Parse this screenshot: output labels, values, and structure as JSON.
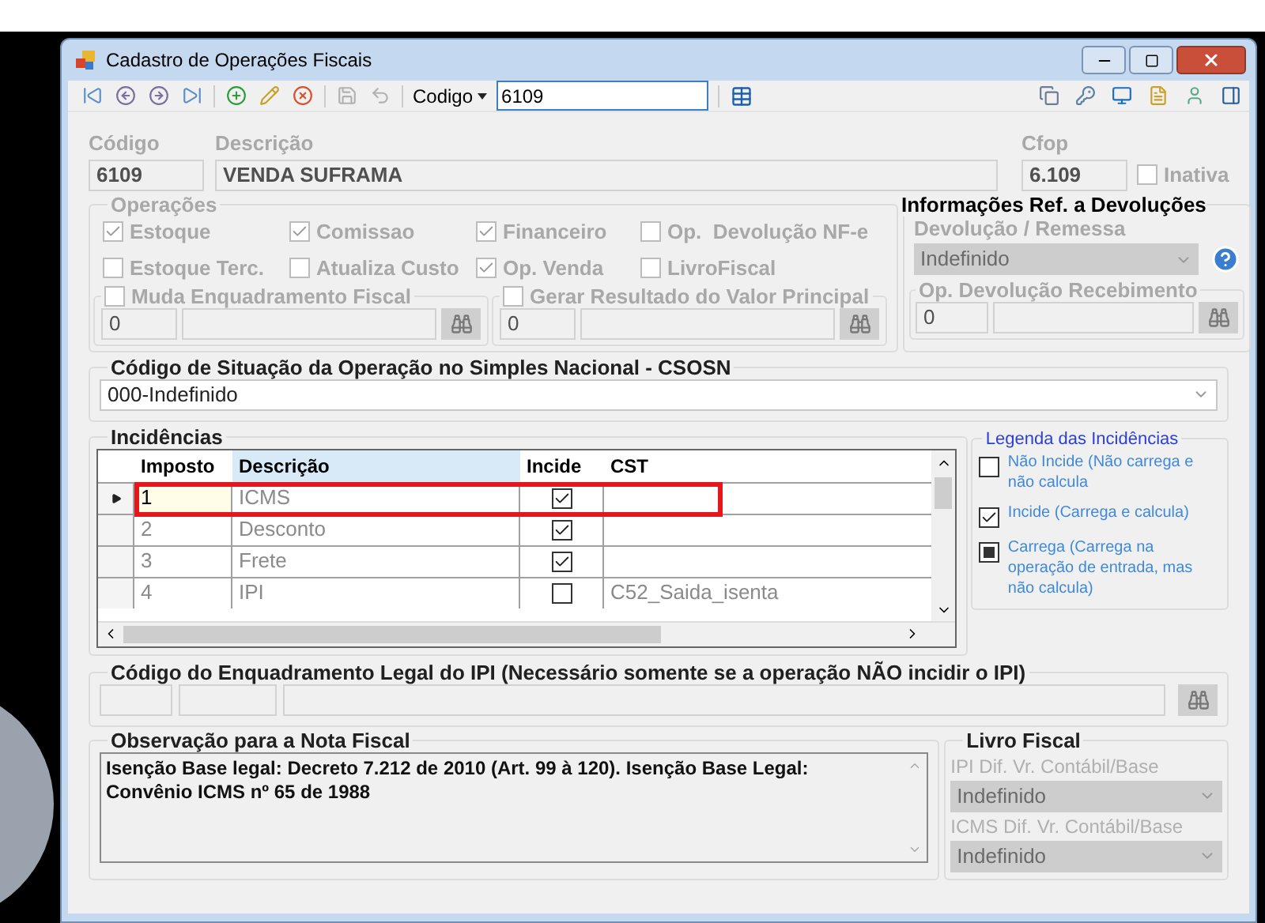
{
  "window": {
    "title": "Cadastro de Operações Fiscais"
  },
  "toolbar": {
    "buttons": [
      {
        "kind": "first",
        "disabled": false
      },
      {
        "kind": "prev",
        "disabled": false
      },
      {
        "kind": "next",
        "disabled": false
      },
      {
        "kind": "last",
        "disabled": false
      },
      {
        "kind": "add",
        "disabled": false
      },
      {
        "kind": "edit",
        "disabled": false
      },
      {
        "kind": "delete",
        "disabled": false
      },
      {
        "kind": "save",
        "disabled": true
      },
      {
        "kind": "undo",
        "disabled": true
      }
    ],
    "search_by": "Codigo",
    "search_value": "6109",
    "right_buttons": [
      {
        "kind": "copy"
      },
      {
        "kind": "key"
      },
      {
        "kind": "monitor"
      },
      {
        "kind": "document"
      },
      {
        "kind": "user"
      },
      {
        "kind": "panel"
      }
    ]
  },
  "header": {
    "codigo": {
      "label": "Código",
      "value": "6109"
    },
    "descricao": {
      "label": "Descrição",
      "value": "VENDA SUFRAMA"
    },
    "cfop": {
      "label": "Cfop",
      "value": "6.109"
    },
    "inativa": {
      "label": "Inativa",
      "checked": false
    }
  },
  "operacoes": {
    "title": "Operações",
    "checkboxes": [
      {
        "label": "Estoque",
        "checked": true
      },
      {
        "label": "Comissao",
        "checked": true
      },
      {
        "label": "Financeiro",
        "checked": true
      },
      {
        "label": "Op.  Devolução NF-e",
        "checked": false
      },
      {
        "label": "Estoque Terc.",
        "checked": false
      },
      {
        "label": "Atualiza Custo",
        "checked": false
      },
      {
        "label": "Op. Venda",
        "checked": true
      },
      {
        "label": "LivroFiscal",
        "checked": false
      }
    ],
    "subgroups": [
      {
        "label": "Muda Enquadramento Fiscal",
        "checked": false,
        "code": "0"
      },
      {
        "label": "Gerar Resultado do Valor Principal",
        "checked": false,
        "code": "0"
      }
    ]
  },
  "devolucoes": {
    "title": "Informações Ref. a Devoluções",
    "remessa_label": "Devolução / Remessa",
    "remessa_value": "Indefinido",
    "recebimento": {
      "label": "Op. Devolução Recebimento",
      "code": "0"
    }
  },
  "csosn": {
    "title": "Código de Situação da Operação no Simples Nacional - CSOSN",
    "value": "000-Indefinido"
  },
  "incidencias": {
    "title": "Incidências",
    "columns": [
      "Imposto",
      "Descrição",
      "Incide",
      "CST"
    ],
    "rows": [
      {
        "imposto": "1",
        "descricao": "ICMS",
        "incide": true,
        "cst": "",
        "selected": true
      },
      {
        "imposto": "2",
        "descricao": "Desconto",
        "incide": true,
        "cst": "",
        "selected": false
      },
      {
        "imposto": "3",
        "descricao": "Frete",
        "incide": true,
        "cst": "",
        "selected": false
      },
      {
        "imposto": "4",
        "descricao": "IPI",
        "incide": false,
        "cst": "C52_Saida_isenta",
        "selected": false
      }
    ]
  },
  "legend": {
    "title": "Legenda das Incidências",
    "items": [
      {
        "kind": "unchecked",
        "label": "Não Incide (Não carrega e não calcula"
      },
      {
        "kind": "checked",
        "label": "Incide (Carrega e calcula)"
      },
      {
        "kind": "filled",
        "label": "Carrega (Carrega na operação de entrada, mas não calcula)"
      }
    ]
  },
  "enquadramento": {
    "title": "Código do Enquadramento Legal do IPI (Necessário somente se a operação NÃO incidir o IPI)"
  },
  "observacao": {
    "title": "Observação para a Nota Fiscal",
    "text": "Isenção Base legal: Decreto 7.212 de 2010 (Art. 99 à 120).  Isenção Base Legal: Convênio ICMS nº 65 de 1988"
  },
  "livro_fiscal": {
    "title": "Livro Fiscal",
    "fields": [
      {
        "label": "IPI Dif. Vr. Contábil/Base",
        "value": "Indefinido"
      },
      {
        "label": "ICMS Dif. Vr. Contábil/Base",
        "value": "Indefinido"
      }
    ]
  }
}
